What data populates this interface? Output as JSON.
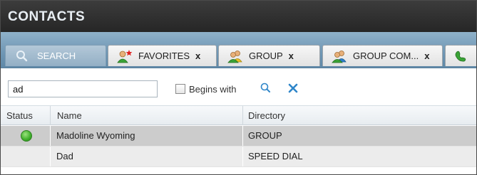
{
  "panel": {
    "title": "CONTACTS"
  },
  "tabs": [
    {
      "label": "SEARCH",
      "icon": "search-icon",
      "closable": false,
      "active": true
    },
    {
      "label": "FAVORITES",
      "icon": "favorites-contact-icon",
      "close_label": "x",
      "active": false
    },
    {
      "label": "GROUP",
      "icon": "group-icon",
      "close_label": "x",
      "active": false
    },
    {
      "label": "GROUP COM...",
      "icon": "group-common-icon",
      "close_label": "x",
      "active": false
    },
    {
      "label": "",
      "icon": "phone-directory-icon",
      "active": false
    }
  ],
  "search": {
    "value": "ad",
    "begins_with_label": "Begins with",
    "begins_with_checked": false
  },
  "table": {
    "columns": [
      "Status",
      "Name",
      "Directory"
    ],
    "rows": [
      {
        "status": "available",
        "name": "Madoline Wyoming",
        "directory": "GROUP",
        "selected": true
      },
      {
        "status": "",
        "name": "Dad",
        "directory": "SPEED DIAL",
        "selected": false
      }
    ]
  },
  "colors": {
    "accent": "#7a9fbd",
    "title_bar": "#2d2d2d",
    "selected_row": "#cccccc",
    "presence_available": "#3eae2a",
    "clear_icon": "#2f86c9"
  }
}
